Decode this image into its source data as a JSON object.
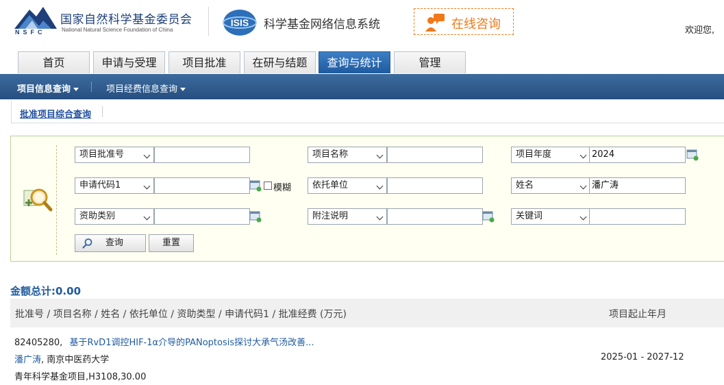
{
  "header": {
    "org_name_cn": "国家自然科学基金委员会",
    "org_name_en": "National Natural Science Foundation of China",
    "org_abbr": "NSFC",
    "system_name": "科学基金网络信息系统",
    "online_consult": "在线咨询",
    "welcome": "欢迎您,"
  },
  "tabs": [
    {
      "label": "首页"
    },
    {
      "label": "申请与受理"
    },
    {
      "label": "项目批准"
    },
    {
      "label": "在研与结题"
    },
    {
      "label": "查询与统计",
      "active": true
    },
    {
      "label": "管理"
    }
  ],
  "subnav": {
    "items": [
      {
        "label": "项目信息查询",
        "active": true
      },
      {
        "label": "项目经费信息查询"
      }
    ]
  },
  "breadcrumb": {
    "label": "批准项目综合查询"
  },
  "search": {
    "row1": {
      "field1_label": "项目批准号",
      "field1_value": "",
      "field2_label": "项目名称",
      "field2_value": "",
      "field3_label": "项目年度",
      "field3_value": "2024"
    },
    "row2": {
      "field1_label": "申请代码1",
      "field1_value": "",
      "fuzzy_label": "模糊",
      "field2_label": "依托单位",
      "field2_value": "",
      "field3_label": "姓名",
      "field3_value": "潘广涛"
    },
    "row3": {
      "field1_label": "资助类别",
      "field1_value": "",
      "field2_label": "附注说明",
      "field2_value": "",
      "field3_label": "关键词",
      "field3_value": ""
    },
    "query_button": "查询",
    "reset_button": "重置"
  },
  "results": {
    "total_label": "金额总计:",
    "total_value": "0.00",
    "header_left": "批准号 / 项目名称 / 姓名 / 依托单位 / 资助类型 / 申请代码1 / 批准经费 (万元)",
    "header_right": "项目起止年月",
    "rows": [
      {
        "approval_no": "82405280,",
        "project_name": "基于RvD1调控HIF-1α介导的PANoptosis探讨大承气汤改善...",
        "person": "潘广涛",
        "institution": "南京中医药大学",
        "funding_line": "青年科学基金项目,H3108,30.00",
        "period": "2025-01 - 2027-12"
      }
    ]
  },
  "colors": {
    "brand_blue": "#1f5aa0",
    "subnav_blue": "#264f80",
    "accent_orange": "#f07a1a",
    "panel_bg": "#fffff2"
  }
}
